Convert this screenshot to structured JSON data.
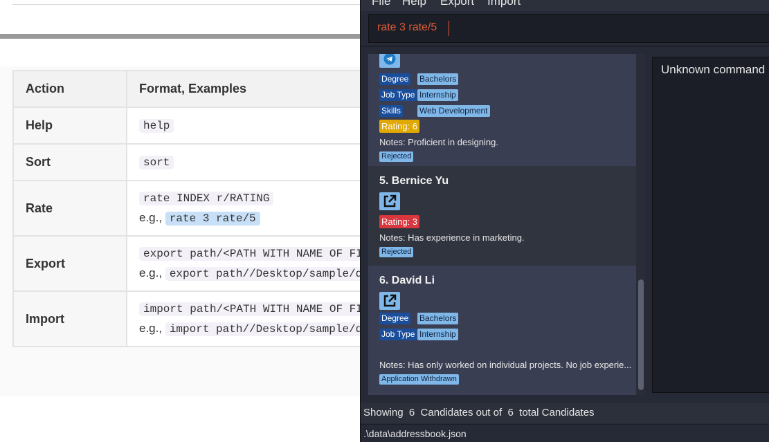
{
  "doc": {
    "headers": [
      "Action",
      "Format, Examples"
    ],
    "rows": [
      {
        "action": "Help",
        "format": "help",
        "example": ""
      },
      {
        "action": "Sort",
        "format": "sort",
        "example": ""
      },
      {
        "action": "Rate",
        "format": "rate INDEX r/RATING",
        "example": "rate 3 rate/5"
      },
      {
        "action": "Export",
        "format": "export path/<PATH WITH NAME OF FI",
        "example": "export path//Desktop/sample/d"
      },
      {
        "action": "Import",
        "format": "import path/<PATH WITH NAME OF FI",
        "example": "import path//Desktop/sample/d"
      }
    ],
    "eg_label": "e.g.,"
  },
  "app": {
    "menu": [
      "File",
      "Help",
      "Export",
      "Import"
    ],
    "command_input": "rate 3 rate/5",
    "result_text": "Unknown command",
    "status": "Showing  6  Candidates out of  6  total Candidates",
    "file_path": ".\\data\\addressbook.json",
    "cards": {
      "c4": {
        "tags": [
          {
            "key": "Degree",
            "value": "Bachelors"
          },
          {
            "key": "Job Type",
            "value": "Internship"
          },
          {
            "key": "Skills",
            "value": "Web Development"
          }
        ],
        "rating": "Rating: 6",
        "notes": "Notes: Proficient in designing.",
        "status": "Rejected"
      },
      "c5": {
        "name": "5.  Bernice Yu",
        "rating": "Rating: 3",
        "notes": "Notes: Has experience in marketing.",
        "status": "Rejected"
      },
      "c6": {
        "name": "6.  David Li",
        "tags": [
          {
            "key": "Degree",
            "value": "Bachelors"
          },
          {
            "key": "Job Type",
            "value": "Internship"
          }
        ],
        "notes": "Notes: Has only worked on individual projects. No job experie...",
        "status": "Application Withdrawn"
      }
    }
  },
  "colors": {
    "accent_blue": "#7fb7e8",
    "tag_dark_blue": "#1a4e9b",
    "rating_yellow": "#e0a800",
    "rating_red": "#d9363e",
    "command_text": "#e05a3a"
  },
  "icons": [
    "telegram-icon",
    "external-link-icon"
  ]
}
